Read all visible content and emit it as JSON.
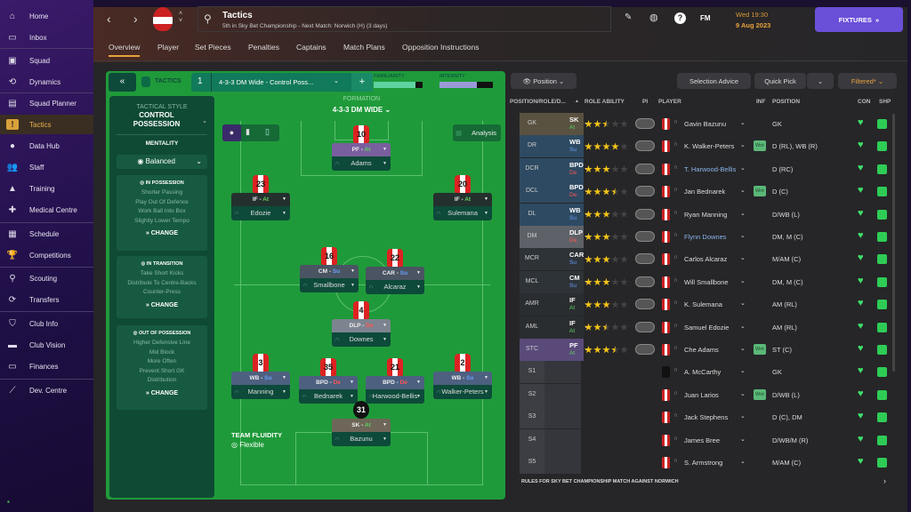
{
  "sidebar": {
    "items": [
      {
        "label": "Home",
        "icon": "home-icon",
        "g": "⌂"
      },
      {
        "label": "Inbox",
        "icon": "inbox-icon",
        "g": "▭"
      },
      {
        "label": "Squad",
        "icon": "shirt-icon",
        "g": "▣"
      },
      {
        "label": "Dynamics",
        "icon": "dynamics-icon",
        "g": "⟲"
      },
      {
        "label": "Squad Planner",
        "icon": "clipboard-icon",
        "g": "▤"
      },
      {
        "label": "Tactics",
        "icon": "tactics-icon",
        "g": "!",
        "active": true
      },
      {
        "label": "Data Hub",
        "icon": "data-hub-icon",
        "g": "●"
      },
      {
        "label": "Staff",
        "icon": "staff-icon",
        "g": "👥"
      },
      {
        "label": "Training",
        "icon": "training-icon",
        "g": "▲"
      },
      {
        "label": "Medical Centre",
        "icon": "medical-icon",
        "g": "✚"
      },
      {
        "label": "Schedule",
        "icon": "calendar-icon",
        "g": "▦"
      },
      {
        "label": "Competitions",
        "icon": "trophy-icon",
        "g": "🏆"
      },
      {
        "label": "Scouting",
        "icon": "search-icon",
        "g": "⚲"
      },
      {
        "label": "Transfers",
        "icon": "transfers-icon",
        "g": "⟳"
      },
      {
        "label": "Club Info",
        "icon": "shield-icon",
        "g": "⛉"
      },
      {
        "label": "Club Vision",
        "icon": "briefcase-icon",
        "g": "▬"
      },
      {
        "label": "Finances",
        "icon": "money-icon",
        "g": "▭"
      },
      {
        "label": "Dev. Centre",
        "icon": "dev-centre-icon",
        "g": "⟋"
      }
    ]
  },
  "header": {
    "title": "Tactics",
    "subtitle": "5th in Sky Bet Championship - Next Match: Norwich (H) (3 days)",
    "fm": "FM",
    "time": "Wed 19:30",
    "date": "9 Aug 2023",
    "fixtures": "FIXTURES"
  },
  "tabs": [
    "Overview",
    "Player",
    "Set Pieces",
    "Penalties",
    "Captains",
    "Match Plans",
    "Opposition Instructions"
  ],
  "tacticsbar": {
    "label": "TACTICS",
    "slot": "1",
    "name": "4-3-3 DM Wide - Control Poss...",
    "familiarity_label": "FAMILIARITY",
    "intensity_label": "INTENSITY",
    "familiarity": 0.85,
    "intensity": 0.7
  },
  "style": {
    "title": "TACTICAL STYLE",
    "value": "CONTROL POSSESSION",
    "mentality_label": "MENTALITY",
    "mentality": "Balanced",
    "groups": [
      {
        "title": "IN POSSESSION",
        "lines": [
          "Shorter Passing",
          "Play Out Of Defence",
          "Work Ball Into Box",
          "Slightly Lower Tempo"
        ],
        "change": "CHANGE"
      },
      {
        "title": "IN TRANSITION",
        "lines": [
          "Take Short Kicks",
          "Distribute To Centre-Backs",
          "Counter-Press"
        ],
        "change": "CHANGE"
      },
      {
        "title": "OUT OF POSSESSION",
        "lines": [
          "Higher Defensive Line",
          "Mid Block",
          "More Often",
          "Prevent Short GK",
          "Distribution"
        ],
        "change": "CHANGE"
      }
    ]
  },
  "formation": {
    "label": "FORMATION",
    "value": "4-3-3 DM WIDE",
    "analysis": "Analysis",
    "fluidity_label": "TEAM FLUIDITY",
    "fluidity": "Flexible",
    "players": [
      {
        "num": "10",
        "role": "PF",
        "duty": "At",
        "name": "Adams",
        "color": "#7a5f9e"
      },
      {
        "num": "23",
        "role": "IF",
        "duty": "At",
        "name": "Edozie",
        "color": "#24302e"
      },
      {
        "num": "20",
        "role": "IF",
        "duty": "At",
        "name": "Sulemana",
        "color": "#24302e"
      },
      {
        "num": "16",
        "role": "CM",
        "duty": "Su",
        "name": "Smallbone",
        "color": "#4a5462"
      },
      {
        "num": "22",
        "role": "CAR",
        "duty": "Su",
        "name": "Alcaraz",
        "color": "#4a5462"
      },
      {
        "num": "4",
        "role": "DLP",
        "duty": "De",
        "name": "Downes",
        "color": "#7c8490"
      },
      {
        "num": "3",
        "role": "WB",
        "duty": "Su",
        "name": "Manning",
        "color": "#4d6080"
      },
      {
        "num": "35",
        "role": "BPD",
        "duty": "De",
        "name": "Bednarek",
        "color": "#4d6080"
      },
      {
        "num": "21",
        "role": "BPD",
        "duty": "De",
        "name": "Harwood-Bellis",
        "color": "#4d6080"
      },
      {
        "num": "2",
        "role": "WB",
        "duty": "Su",
        "name": "Walker-Peters",
        "color": "#4d6080"
      },
      {
        "num": "31",
        "role": "SK",
        "duty": "At",
        "name": "Bazunu",
        "color": "#6e6658",
        "gk": true
      }
    ]
  },
  "toolbar": {
    "position": "Position",
    "selection_advice": "Selection Advice",
    "quick_pick": "Quick Pick",
    "filtered": "Filtered*"
  },
  "table": {
    "headers": [
      "POSITION/ROLE/D...",
      "ROLE ABILITY",
      "PI",
      "PLAYER",
      "INF",
      "POSITION",
      "CON",
      "SHP"
    ],
    "rows": [
      {
        "pos": "GK",
        "role": "SK",
        "duty": "At",
        "stars": 2.5,
        "player": "Gavin Bazunu",
        "inf": "",
        "position": "GK",
        "bg": "#5a5240"
      },
      {
        "pos": "DR",
        "role": "WB",
        "duty": "Su",
        "stars": 4,
        "player": "K. Walker-Peters",
        "inf": "Wnt",
        "position": "D (RL), WB (R)",
        "bg": "#2e4a62"
      },
      {
        "pos": "DCR",
        "role": "BPD",
        "duty": "De",
        "stars": 3,
        "player": "T. Harwood-Bellis",
        "inf": "",
        "position": "D (RC)",
        "bg": "#2e4a62",
        "link": true
      },
      {
        "pos": "DCL",
        "role": "BPD",
        "duty": "De",
        "stars": 3.5,
        "player": "Jan Bednarek",
        "inf": "Wnt",
        "position": "D (C)",
        "bg": "#2e4a62"
      },
      {
        "pos": "DL",
        "role": "WB",
        "duty": "Su",
        "stars": 3,
        "player": "Ryan Manning",
        "inf": "",
        "position": "D/WB (L)",
        "bg": "#2e4a62"
      },
      {
        "pos": "DM",
        "role": "DLP",
        "duty": "De",
        "stars": 3,
        "player": "Flynn Downes",
        "inf": "",
        "position": "DM, M (C)",
        "bg": "#5e6268",
        "link": true
      },
      {
        "pos": "MCR",
        "role": "CAR",
        "duty": "Su",
        "stars": 3,
        "player": "Carlos Alcaraz",
        "inf": "",
        "position": "M/AM (C)",
        "bg": "#2e3338"
      },
      {
        "pos": "MCL",
        "role": "CM",
        "duty": "Su",
        "stars": 3,
        "player": "Will Smallbone",
        "inf": "",
        "position": "DM, M (C)",
        "bg": "#2e3338"
      },
      {
        "pos": "AMR",
        "role": "IF",
        "duty": "At",
        "stars": 3,
        "player": "K. Sulemana",
        "inf": "",
        "position": "AM (RL)",
        "bg": "#2a2d30"
      },
      {
        "pos": "AML",
        "role": "IF",
        "duty": "At",
        "stars": 2.5,
        "player": "Samuel Edozie",
        "inf": "",
        "position": "AM (RL)",
        "bg": "#2a2d30"
      },
      {
        "pos": "STC",
        "role": "PF",
        "duty": "At",
        "stars": 3.5,
        "player": "Che Adams",
        "inf": "Wnt",
        "position": "ST (C)",
        "bg": "#5a4a7a"
      },
      {
        "pos": "S1",
        "player": "A. McCarthy",
        "inf": "",
        "position": "GK",
        "bg": "#3c3e44",
        "gk": true
      },
      {
        "pos": "S2",
        "player": "Juan Larios",
        "inf": "Wnt",
        "position": "D/WB (L)",
        "bg": "#3c3e44"
      },
      {
        "pos": "S3",
        "player": "Jack Stephens",
        "inf": "",
        "position": "D (C), DM",
        "bg": "#3c3e44"
      },
      {
        "pos": "S4",
        "player": "James Bree",
        "inf": "",
        "position": "D/WB/M (R)",
        "bg": "#3c3e44"
      },
      {
        "pos": "S5",
        "player": "S. Armstrong",
        "inf": "",
        "position": "M/AM (C)",
        "bg": "#3c3e44"
      }
    ]
  },
  "footer": "RULES FOR SKY BET CHAMPIONSHIP MATCH AGAINST NORWICH",
  "colors": {
    "accent": "#e8a23a",
    "fixtures": "#6a4fd8",
    "pitch": "#1f9a3a",
    "attack": "#5fd35f",
    "support": "#6aa0ff",
    "defend": "#ff5555"
  }
}
